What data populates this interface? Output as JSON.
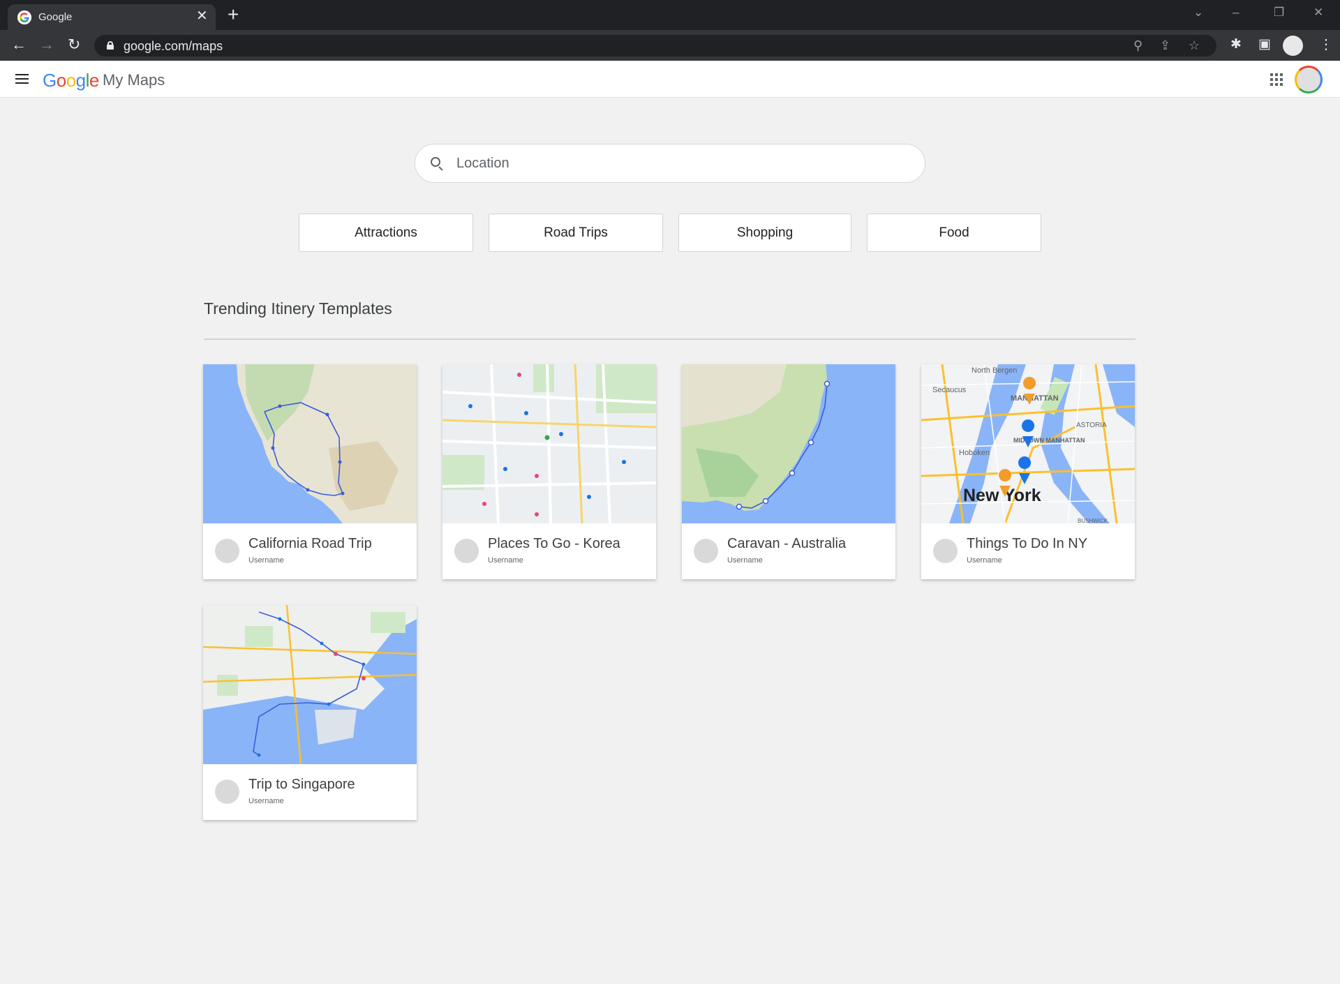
{
  "browser": {
    "tab_title": "Google",
    "tab_close": "✕",
    "new_tab": "+",
    "url": "google.com/maps",
    "window_controls": [
      "⌄",
      "–",
      "❐",
      "✕"
    ]
  },
  "app": {
    "logo_letters": [
      "G",
      "o",
      "o",
      "g",
      "l",
      "e"
    ],
    "product_name": "My Maps"
  },
  "search": {
    "placeholder": "Location",
    "value": ""
  },
  "chips": [
    {
      "label": "Attractions"
    },
    {
      "label": "Road Trips"
    },
    {
      "label": "Shopping"
    },
    {
      "label": "Food"
    }
  ],
  "section": {
    "title": "Trending Itinery Templates"
  },
  "cards": [
    {
      "title": "California Road Trip",
      "user": "Username",
      "map": "california"
    },
    {
      "title": "Places To Go - Korea",
      "user": "Username",
      "map": "korea"
    },
    {
      "title": "Caravan - Australia",
      "user": "Username",
      "map": "australia"
    },
    {
      "title": "Things To Do In NY",
      "user": "Username",
      "map": "new-york",
      "map_labels": [
        "North Bergen",
        "Secaucus",
        "MANHATTAN",
        "ASTORIA",
        "Hoboken",
        "MIDTOWN MANHATTAN",
        "New York",
        "BUSHWICK"
      ]
    },
    {
      "title": "Trip to Singapore",
      "user": "Username",
      "map": "singapore"
    }
  ],
  "colors": {
    "water": "#8ab4f8",
    "land": "#e8e6da",
    "route": "#3b5bdb",
    "pin_orange": "#f29c2b",
    "pin_blue": "#1a73e8"
  }
}
